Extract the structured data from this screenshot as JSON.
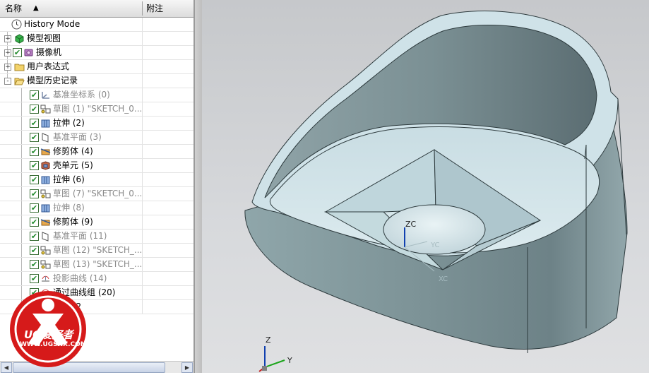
{
  "navigator": {
    "columns": {
      "name": "名称",
      "note": "附注"
    },
    "rows": [
      {
        "label": "History Mode",
        "icon": "history-clock-icon",
        "level": 1,
        "checked": null,
        "expander": null,
        "dim": false
      },
      {
        "label": "模型视图",
        "icon": "model-views-icon",
        "level": 1,
        "checked": null,
        "expander": "+",
        "dim": false
      },
      {
        "label": "摄像机",
        "icon": "camera-icon",
        "level": 1,
        "checked": true,
        "expander": "+",
        "dim": false
      },
      {
        "label": "用户表达式",
        "icon": "folder-icon",
        "level": 1,
        "checked": null,
        "expander": "+",
        "dim": false
      },
      {
        "label": "模型历史记录",
        "icon": "folder-open-icon",
        "level": 1,
        "checked": null,
        "expander": "-",
        "dim": false
      },
      {
        "label": "基准坐标系 (0)",
        "icon": "datum-csys-icon",
        "level": 2,
        "checked": true,
        "expander": null,
        "dim": true
      },
      {
        "label": "草图 (1) \"SKETCH_0...",
        "icon": "sketch-icon",
        "level": 2,
        "checked": true,
        "expander": null,
        "dim": true
      },
      {
        "label": "拉伸 (2)",
        "icon": "extrude-icon",
        "level": 2,
        "checked": true,
        "expander": null,
        "dim": false
      },
      {
        "label": "基准平面 (3)",
        "icon": "datum-plane-icon",
        "level": 2,
        "checked": true,
        "expander": null,
        "dim": true
      },
      {
        "label": "修剪体 (4)",
        "icon": "trim-body-icon",
        "level": 2,
        "checked": true,
        "expander": null,
        "dim": false
      },
      {
        "label": "壳单元 (5)",
        "icon": "shell-icon",
        "level": 2,
        "checked": true,
        "expander": null,
        "dim": false
      },
      {
        "label": "拉伸 (6)",
        "icon": "extrude-icon",
        "level": 2,
        "checked": true,
        "expander": null,
        "dim": false
      },
      {
        "label": "草图 (7) \"SKETCH_0...",
        "icon": "sketch-icon",
        "level": 2,
        "checked": true,
        "expander": null,
        "dim": true
      },
      {
        "label": "拉伸 (8)",
        "icon": "extrude-icon",
        "level": 2,
        "checked": true,
        "expander": null,
        "dim": true
      },
      {
        "label": "修剪体 (9)",
        "icon": "trim-body-icon",
        "level": 2,
        "checked": true,
        "expander": null,
        "dim": false
      },
      {
        "label": "基准平面 (11)",
        "icon": "datum-plane-icon",
        "level": 2,
        "checked": true,
        "expander": null,
        "dim": true
      },
      {
        "label": "草图 (12) \"SKETCH_...",
        "icon": "sketch-icon",
        "level": 2,
        "checked": true,
        "expander": null,
        "dim": true
      },
      {
        "label": "草图 (13) \"SKETCH_...",
        "icon": "sketch-icon",
        "level": 2,
        "checked": true,
        "expander": null,
        "dim": true
      },
      {
        "label": "投影曲线 (14)",
        "icon": "project-curve-icon",
        "level": 2,
        "checked": true,
        "expander": null,
        "dim": true
      },
      {
        "label": "通过曲线组 (20)",
        "icon": "through-curves-icon",
        "level": 2,
        "checked": true,
        "expander": null,
        "dim": false
      },
      {
        "label": "求差 (2",
        "icon": "subtract-icon",
        "level": 2,
        "checked": true,
        "expander": null,
        "dim": false
      }
    ]
  },
  "viewport": {
    "csys_labels": {
      "zc": "ZC",
      "yc": "YC",
      "xc": "XC"
    },
    "triad_labels": {
      "z": "Z",
      "y": "Y"
    }
  },
  "watermark": {
    "brand": "UG爱好者",
    "url": "WWW.UGSNX.COM"
  },
  "colors": {
    "part_face": "#d4e6ec",
    "part_side": "#7f9498",
    "viewport_bg": "#d3d5d8",
    "checkbox_green": "#1f8a2a",
    "logo_red": "#d61a1a"
  }
}
